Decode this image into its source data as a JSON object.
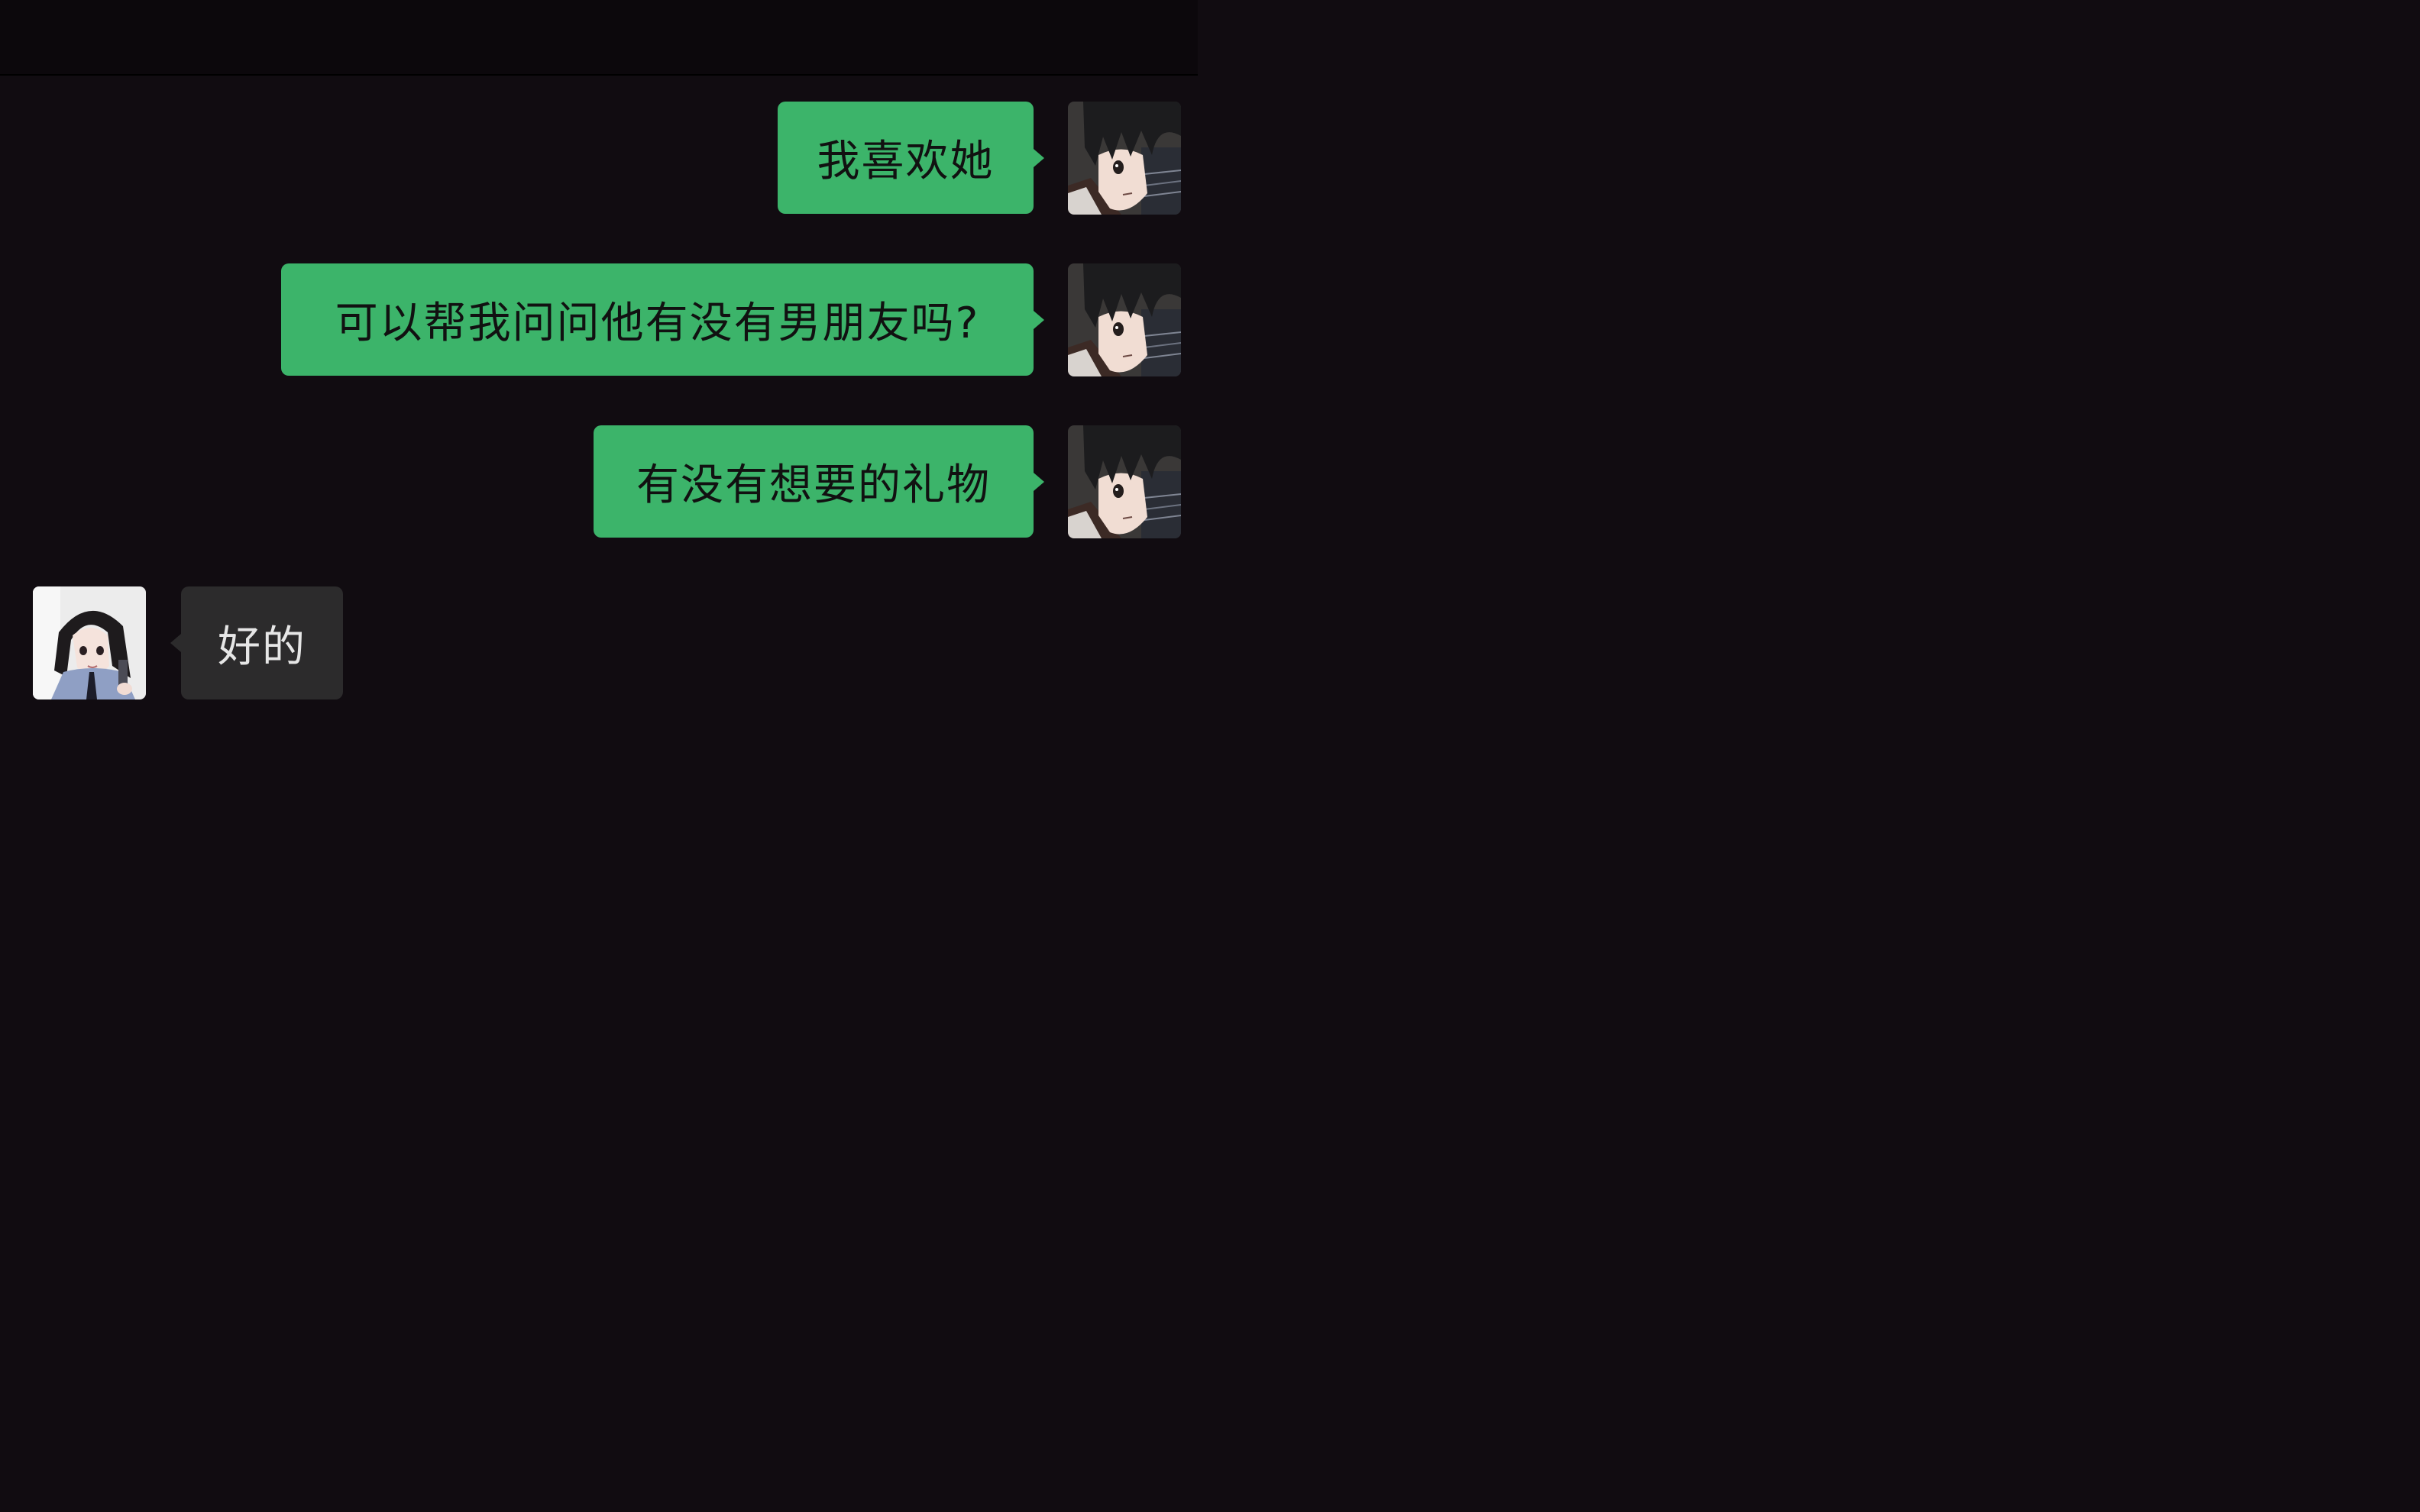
{
  "conversation": {
    "messages": [
      {
        "direction": "outgoing",
        "text": "我喜欢她",
        "avatar_icon": "user-avatar-anime-boy-icon"
      },
      {
        "direction": "outgoing",
        "text": "可以帮我问问他有没有男朋友吗?",
        "avatar_icon": "user-avatar-anime-boy-icon"
      },
      {
        "direction": "outgoing",
        "text": "有没有想要的礼物",
        "avatar_icon": "user-avatar-anime-boy-icon"
      },
      {
        "direction": "incoming",
        "text": "好的",
        "avatar_icon": "contact-avatar-anime-girl-icon"
      }
    ]
  },
  "colors": {
    "background": "#110c11",
    "outgoing_bubble": "#3cb46a",
    "incoming_bubble": "#2c2b2c",
    "outgoing_text": "#111111",
    "incoming_text": "#e6e6e6"
  }
}
